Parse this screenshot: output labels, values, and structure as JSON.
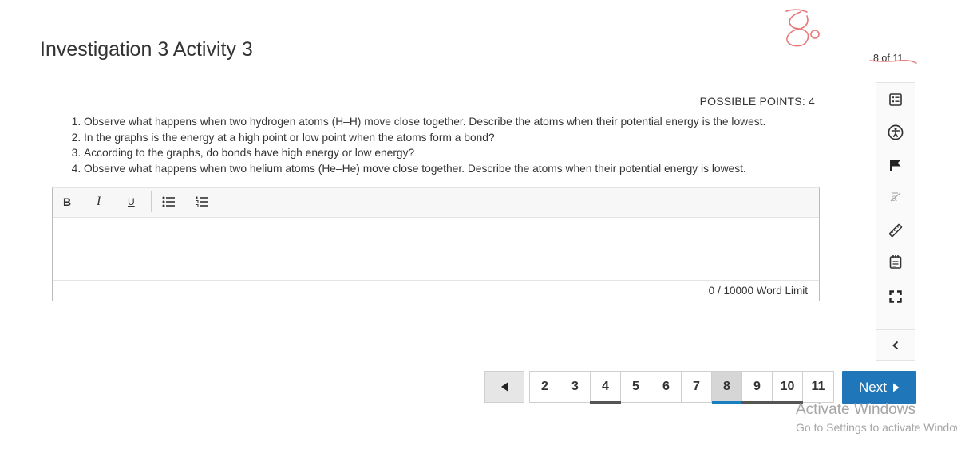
{
  "header": {
    "title": "Investigation 3 Activity 3",
    "progress": "8 of 11"
  },
  "question": {
    "points_label": "POSSIBLE POINTS: 4",
    "items": [
      "Observe what happens when two hydrogen atoms (H–H) move close together. Describe the atoms when their potential energy is the lowest.",
      "In the graphs is the energy at a high point or low point when the atoms form a bond?",
      "According to the graphs, do bonds have high energy or low energy?",
      "Observe what happens when two helium atoms (He–He) move close together. Describe the atoms when their potential energy is lowest."
    ]
  },
  "editor": {
    "toolbar": {
      "bold": "B",
      "italic": "I",
      "underline": "U"
    },
    "content": "",
    "word_count": "0",
    "word_limit_text": "/ 10000 Word Limit"
  },
  "sidebar": {
    "icons": [
      "question-list-icon",
      "accessibility-icon",
      "flag-icon",
      "strikethrough-icon",
      "ruler-icon",
      "notepad-icon",
      "fullscreen-icon",
      "collapse-chevron-icon"
    ]
  },
  "pagination": {
    "pages": [
      {
        "label": "2",
        "state": "normal"
      },
      {
        "label": "3",
        "state": "normal"
      },
      {
        "label": "4",
        "state": "visited"
      },
      {
        "label": "5",
        "state": "normal"
      },
      {
        "label": "6",
        "state": "normal"
      },
      {
        "label": "7",
        "state": "normal"
      },
      {
        "label": "8",
        "state": "current"
      },
      {
        "label": "9",
        "state": "visited"
      },
      {
        "label": "10",
        "state": "visited"
      },
      {
        "label": "11",
        "state": "normal"
      }
    ],
    "next_label": "Next"
  },
  "watermark": {
    "line1": "Activate Windows",
    "line2": "Go to Settings to activate Windows."
  },
  "colors": {
    "accent": "#1f76b8",
    "annotation_ink": "#e87878"
  }
}
